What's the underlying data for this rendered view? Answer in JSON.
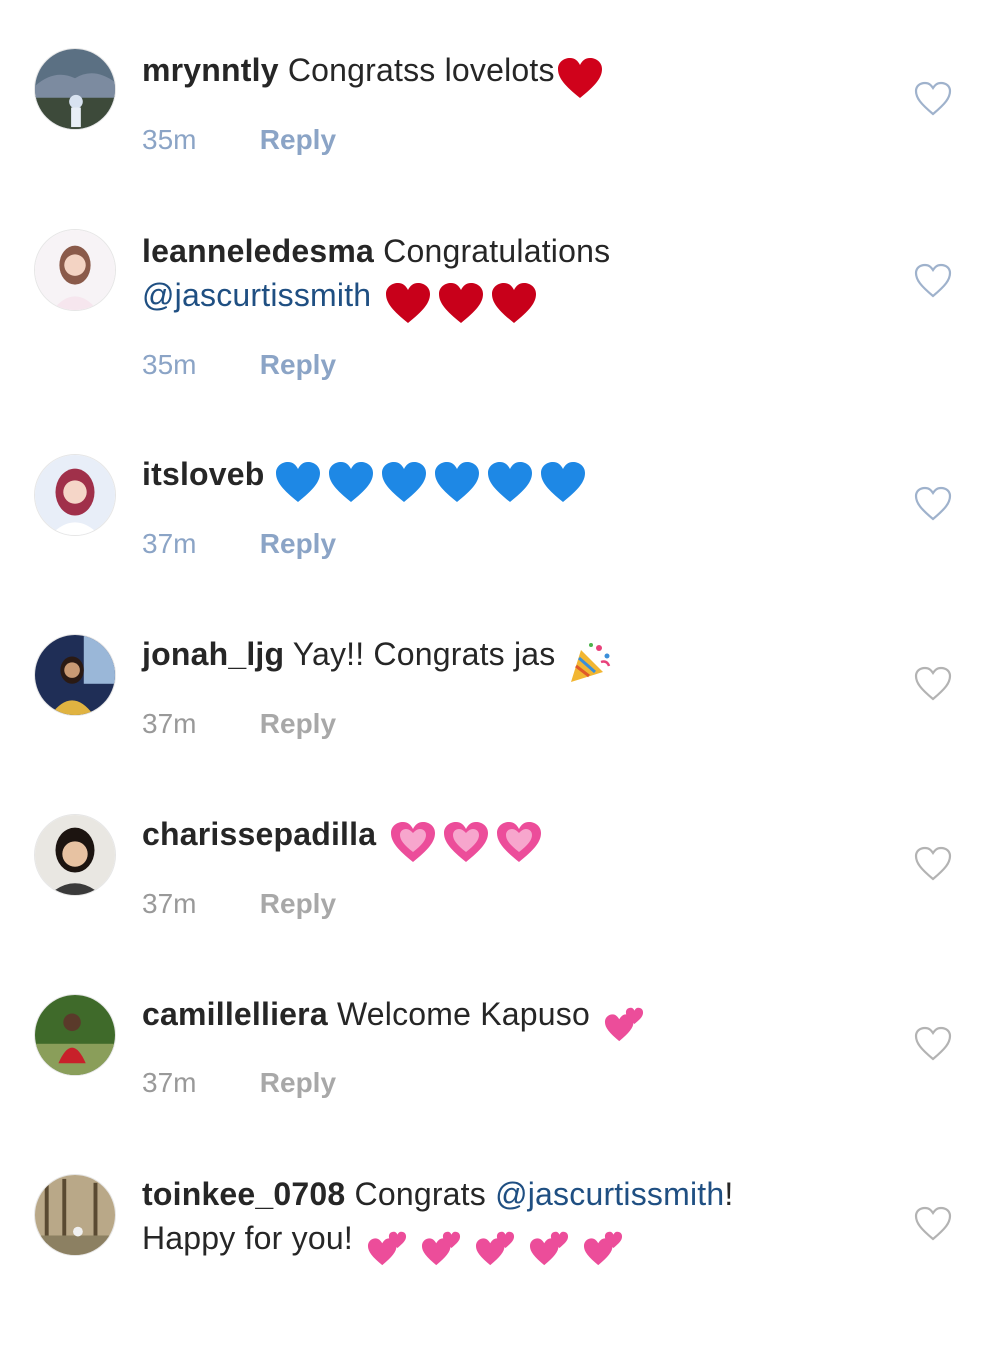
{
  "comments": [
    {
      "username": "mrynntly",
      "text_line1": "Congratss lovelots",
      "emoji": "red-heart",
      "time": "35m",
      "reply": "Reply"
    },
    {
      "username": "leanneledesma",
      "text_line1": "Congratulations",
      "mention": "@jascurtissmith",
      "emoji": "red-heart",
      "time": "35m",
      "reply": "Reply"
    },
    {
      "username": "itsloveb",
      "emoji": "blue-heart",
      "time": "37m",
      "reply": "Reply"
    },
    {
      "username": "jonah_ljg",
      "text_line1": "Yay!! Congrats jas",
      "emoji": "party-popper",
      "time": "37m",
      "reply": "Reply"
    },
    {
      "username": "charissepadilla",
      "emoji": "sparkling-heart",
      "time": "37m",
      "reply": "Reply"
    },
    {
      "username": "camillelliera",
      "text_line1": "Welcome Kapuso",
      "emoji": "two-hearts",
      "time": "37m",
      "reply": "Reply"
    },
    {
      "username": "toinkee_0708",
      "text_line1": "Congrats",
      "mention": "@jascurtissmith",
      "after_mention": "!",
      "text_line2": "Happy for you!",
      "emoji": "two-hearts",
      "time": "",
      "reply": ""
    }
  ],
  "icons": {
    "like": "heart-outline-icon"
  },
  "colors": {
    "mention": "#1f4f82",
    "meta_blue": "#8ba4c6",
    "meta_gray": "#999999",
    "red_heart": "#d0021b",
    "blue_heart": "#1e88e5",
    "pink_heart": "#e84393"
  }
}
